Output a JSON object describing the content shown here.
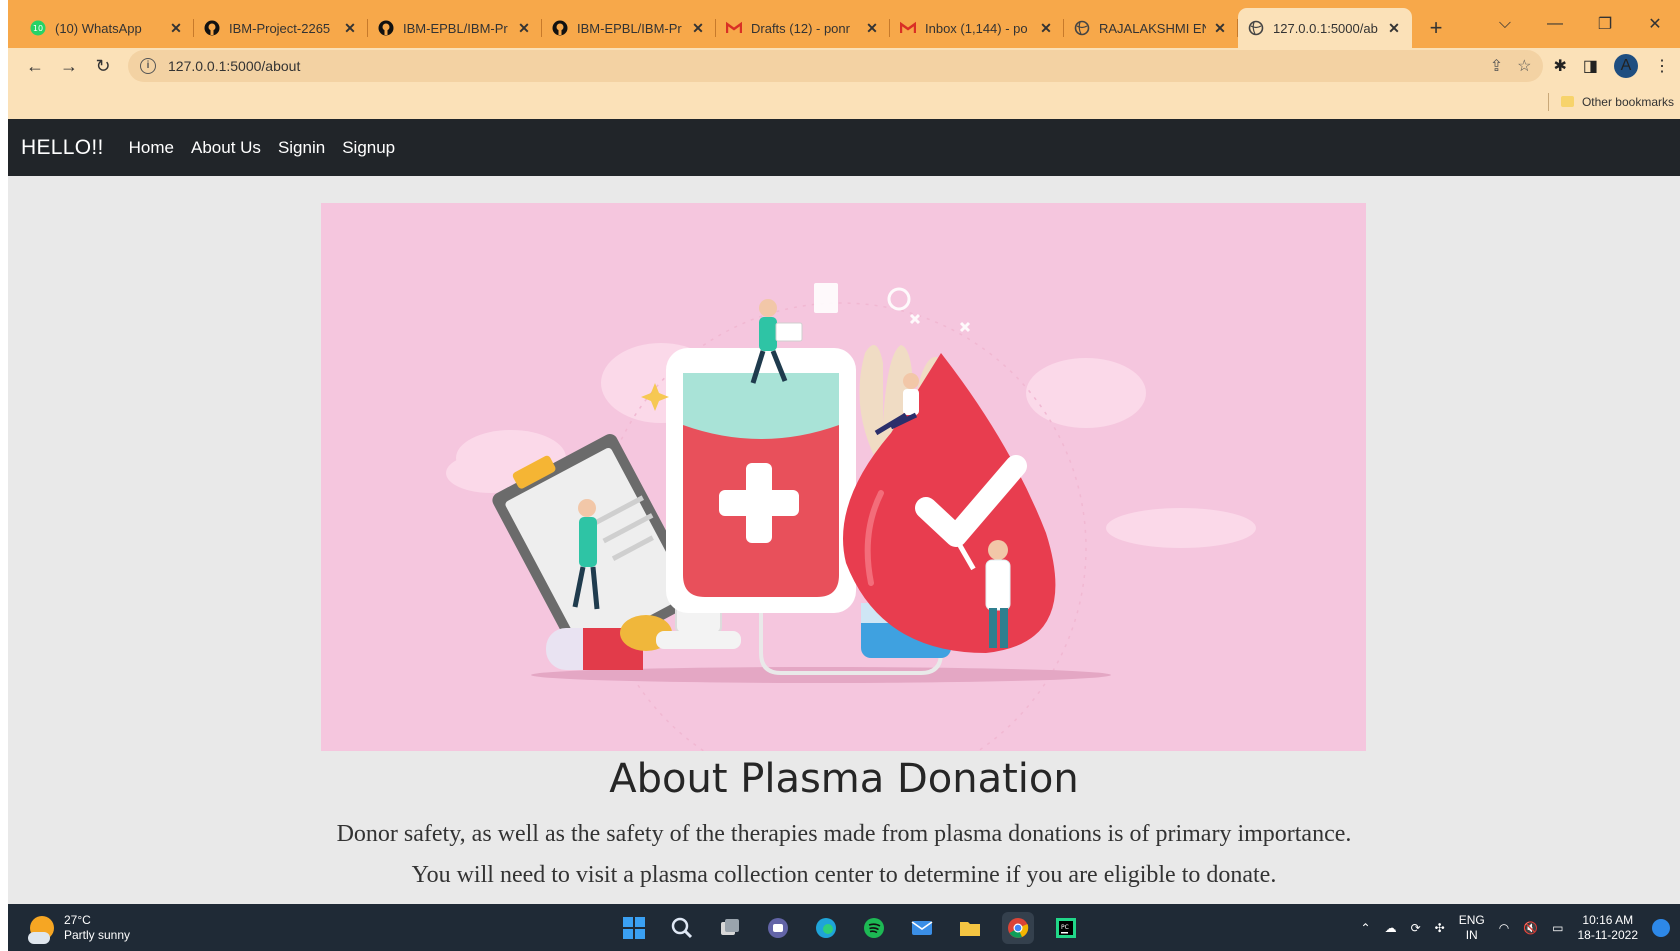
{
  "browser": {
    "tabs": [
      {
        "title": "(10) WhatsApp",
        "icon": "whatsapp-icon",
        "color": "#25d366",
        "active": false
      },
      {
        "title": "IBM-Project-2265",
        "icon": "github-icon",
        "color": "#111111",
        "active": false
      },
      {
        "title": "IBM-EPBL/IBM-Pr",
        "icon": "github-icon",
        "color": "#111111",
        "active": false
      },
      {
        "title": "IBM-EPBL/IBM-Pr",
        "icon": "github-icon",
        "color": "#111111",
        "active": false
      },
      {
        "title": "Drafts (12) - ponr",
        "icon": "gmail-icon",
        "color": "#d93025",
        "active": false
      },
      {
        "title": "Inbox (1,144) - po",
        "icon": "gmail-icon",
        "color": "#d93025",
        "active": false
      },
      {
        "title": "RAJALAKSHMI EN",
        "icon": "globe-icon",
        "color": "#555555",
        "active": false
      },
      {
        "title": "127.0.0.1:5000/ab",
        "icon": "globe-icon",
        "color": "#555555",
        "active": true
      }
    ],
    "url": "127.0.0.1:5000/about",
    "bookmarks_label": "Other bookmarks",
    "profile_initial": "A"
  },
  "site": {
    "brand": "HELLO!!",
    "nav": [
      "Home",
      "About Us",
      "Signin",
      "Signup"
    ],
    "heading": "About Plasma Donation",
    "paragraph_line1": "Donor safety, as well as the safety of the therapies made from plasma donations is of primary importance.",
    "paragraph_line2": "You will need to visit a plasma collection center to determine if you are eligible to donate."
  },
  "colors": {
    "navbar": "#212529",
    "hero_bg": "#f5c6de",
    "blood_red": "#e83d4f",
    "tab_strip": "#f7a84a"
  },
  "taskbar": {
    "temperature": "27°C",
    "weather": "Partly sunny",
    "language": "ENG",
    "region": "IN",
    "time": "10:16 AM",
    "date": "18-11-2022"
  }
}
